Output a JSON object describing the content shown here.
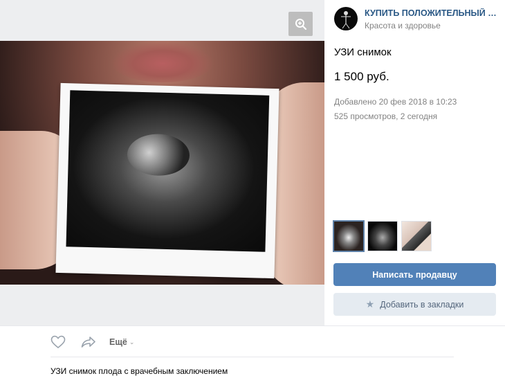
{
  "group": {
    "name": "КУПИТЬ ПОЛОЖИТЕЛЬНЫЙ ТЕСТ ...",
    "category": "Красота и здоровье"
  },
  "item": {
    "title": "УЗИ снимок",
    "price": "1 500 руб.",
    "added": "Добавлено 20 фев 2018 в 10:23",
    "views": "525 просмотров, 2 сегодня",
    "description": "УЗИ снимок плода с врачебным заключением"
  },
  "buttons": {
    "write_seller": "Написать продавцу",
    "add_bookmark": "Добавить в закладки"
  },
  "actions": {
    "more_label": "Ещё"
  },
  "icons": {
    "zoom": "zoom-in-icon",
    "like": "heart-icon",
    "share": "share-arrow-icon",
    "more": "chevron-down-icon",
    "bookmark": "star-icon"
  },
  "colors": {
    "link": "#2a5885",
    "primary_button": "#5181b8",
    "secondary_button": "#e5ebf1",
    "muted_text": "#828282"
  }
}
